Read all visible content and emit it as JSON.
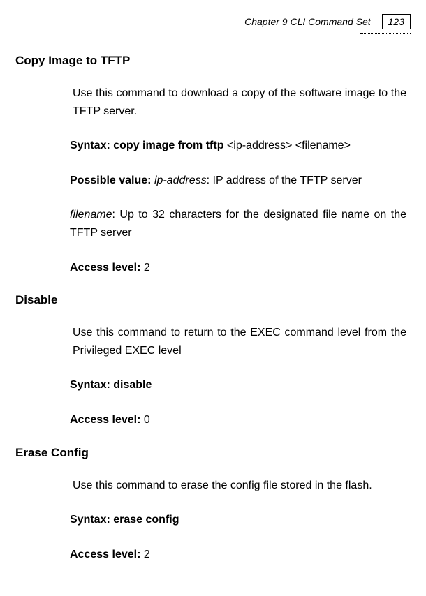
{
  "header": {
    "chapter_title": "Chapter 9 CLI Command Set",
    "page_number": "123"
  },
  "sections": {
    "copy_image": {
      "heading": "Copy Image to TFTP",
      "desc": "Use this command to download a copy of the software image to the TFTP server.",
      "syntax_label": "Syntax: copy image from tftp ",
      "syntax_args": "<ip-address> <filename>",
      "possible_value_label": "Possible value: ",
      "possible_value_key": "ip-address",
      "possible_value_desc": ": IP address of the TFTP server",
      "filename_key": "filename",
      "filename_desc": ": Up to 32 characters for the designated file name on the TFTP server",
      "access_label": "Access level: ",
      "access_value": "2"
    },
    "disable": {
      "heading": "Disable",
      "desc": "Use this command to return to the EXEC command level from the Privileged EXEC level",
      "syntax_label": "Syntax: disable",
      "access_label": "Access level: ",
      "access_value": "0"
    },
    "erase_config": {
      "heading": "Erase Config",
      "desc": "Use this command to erase the config file stored in the flash.",
      "syntax_label": "Syntax: erase config",
      "access_label": "Access level: ",
      "access_value": "2"
    }
  }
}
